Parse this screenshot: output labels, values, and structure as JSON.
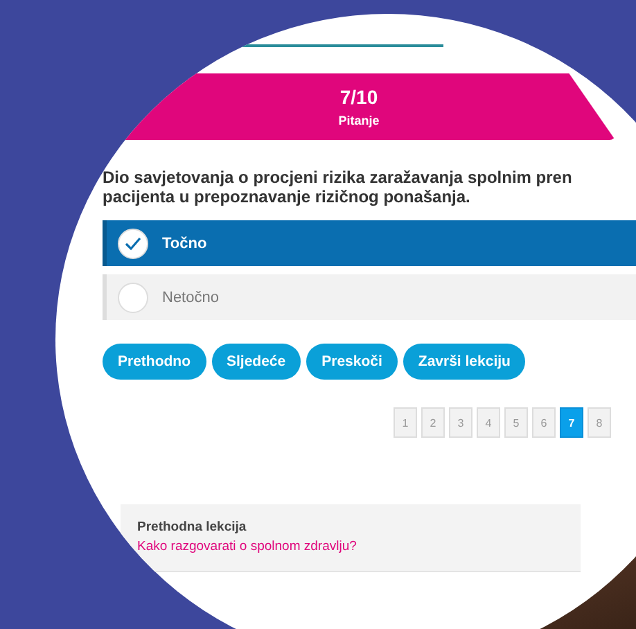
{
  "banner": {
    "counter": "7/10",
    "label": "Pitanje"
  },
  "question": "Dio savjetovanja o procjeni rizika zaražavanja spolnim pren pacijenta u prepoznavanje rizičnog ponašanja.",
  "options": [
    {
      "label": "Točno",
      "selected": true
    },
    {
      "label": "Netočno",
      "selected": false
    }
  ],
  "buttons": [
    "Prethodno",
    "Sljedeće",
    "Preskoči",
    "Završi lekciju"
  ],
  "pagination": [
    {
      "label": "1",
      "selected": false
    },
    {
      "label": "2",
      "selected": false
    },
    {
      "label": "3",
      "selected": false
    },
    {
      "label": "4",
      "selected": false
    },
    {
      "label": "5",
      "selected": false
    },
    {
      "label": "6",
      "selected": false
    },
    {
      "label": "7",
      "selected": true
    },
    {
      "label": "8",
      "selected": false
    }
  ],
  "previous_lesson": {
    "heading": "Prethodna lekcija",
    "link": "Kako razgovarati o spolnom zdravlju?"
  }
}
